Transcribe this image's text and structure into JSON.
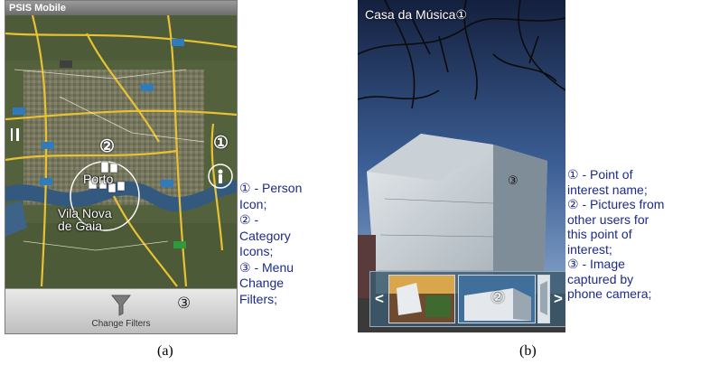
{
  "panel_a": {
    "window_title": "PSIS Mobile",
    "marker_number": "②",
    "person_marker_number": "①",
    "map_places": {
      "porto": "Porto",
      "vila_nova_de_gaia": "Vila Nova\nde Gaia"
    },
    "menu": {
      "change_filters_label": "Change Filters",
      "marker_number": "③"
    },
    "legend": {
      "line1": "① - Person",
      "line2": "Icon;",
      "line3": "② -",
      "line4": "Category",
      "line5": "Icons;",
      "line6": "③ - Menu",
      "line7": "Change",
      "line8": "Filters;"
    },
    "caption": "(a)"
  },
  "panel_b": {
    "poi_name": "Casa da Música",
    "poi_marker_number": "①",
    "photo_marker_number": "③",
    "thumb_marker_number": "②",
    "prev_label": "<",
    "next_label": ">",
    "legend": {
      "line1": "① - Point of",
      "line2": "interest name;",
      "line3": "② - Pictures from",
      "line4": "other users for",
      "line5": "this point of",
      "line6": "interest;",
      "line7": "③ - Image",
      "line8": "captured by",
      "line9": "phone camera;"
    },
    "caption": "(b)"
  },
  "colors": {
    "legend_text": "#1c2b8a",
    "road": "#e8c233",
    "river": "#34597f"
  }
}
